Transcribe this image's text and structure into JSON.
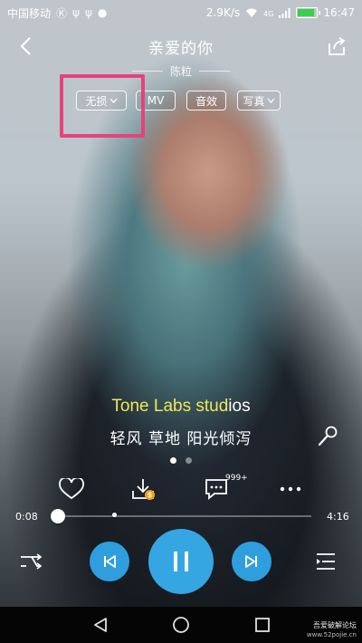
{
  "status_bar": {
    "carrier": "中国移动",
    "network_speed": "2.9K/s",
    "network_type": "4G",
    "time": "16:47",
    "battery_level": 0.8,
    "battery_color": "#3ad04a"
  },
  "header": {
    "title": "亲爱的你",
    "artist": "陈粒"
  },
  "tags": {
    "quality": "无损",
    "mv": "MV",
    "effects": "音效",
    "portrait": "写真"
  },
  "lyrics": {
    "credit_highlight": "Tone Labs stud",
    "credit_rest": "ios",
    "line": "轻风 草地 阳光倾泻",
    "highlight_color": "#f3e55a"
  },
  "actions": {
    "comment_count": "999+",
    "coin_badge": "$"
  },
  "playback": {
    "elapsed": "0:08",
    "total": "4:16",
    "progress": 0.0,
    "buffered": 0.22,
    "state": "playing"
  },
  "pager": {
    "pages": 2,
    "active": 1
  },
  "watermark": {
    "line1": "吾爱破解论坛",
    "line2": "www.52pojie.cn"
  },
  "colors": {
    "accent": "#36a6e3",
    "highlight_box": "#e4437e"
  }
}
